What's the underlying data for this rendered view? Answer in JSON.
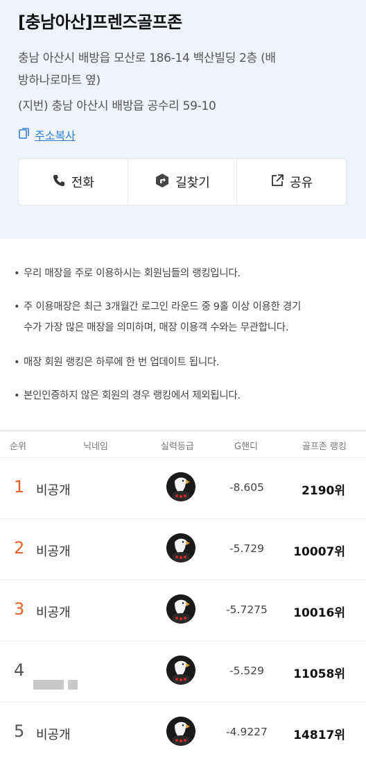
{
  "store": {
    "title": "[충남아산]프렌즈골프존",
    "address_line1": "충남 아산시 배방읍 모산로 186-14 백산빌딩 2층 (배",
    "address_line2": "방하나로마트 옆)",
    "jibun": "(지번) 충남 아산시 배방읍 공수리 59-10",
    "copy_label": "주소복사"
  },
  "actions": [
    {
      "label": "전화",
      "icon": "phone-icon"
    },
    {
      "label": "길찾기",
      "icon": "directions-icon"
    },
    {
      "label": "공유",
      "icon": "share-icon"
    }
  ],
  "notes": [
    "우리 매장을 주로 이용하시는 회원님들의 랭킹입니다.",
    "주 이용매장은 최근 3개월간 로그인 라운드 중 9홀 이상 이용한 경기",
    "수가 가장 많은 매장을 의미하며, 매장 이용객 수와는 무관합니다.",
    "매장 회원 랭킹은 하루에 한 번 업데이트 됩니다.",
    "본인인증하지 않은 회원의 경우 랭킹에서 제외됩니다."
  ],
  "table": {
    "headers": [
      "순위",
      "닉네임",
      "실력등급",
      "G핸디",
      "골프존 랭킹"
    ],
    "rows": [
      {
        "rank": "1",
        "nickname": "비공개",
        "handicap": "-8.605",
        "gz_rank": "2190위"
      },
      {
        "rank": "2",
        "nickname": "비공개",
        "handicap": "-5.729",
        "gz_rank": "10007위"
      },
      {
        "rank": "3",
        "nickname": "비공개",
        "handicap": "-5.7275",
        "gz_rank": "10016위"
      },
      {
        "rank": "4",
        "nickname": "",
        "handicap": "-5.529",
        "gz_rank": "11058위"
      },
      {
        "rank": "5",
        "nickname": "비공개",
        "handicap": "-4.9227",
        "gz_rank": "14817위"
      }
    ]
  },
  "colors": {
    "accent": "#2f7fd6",
    "top_rank": "#e8612c",
    "header_bg": "#eef3f9"
  }
}
